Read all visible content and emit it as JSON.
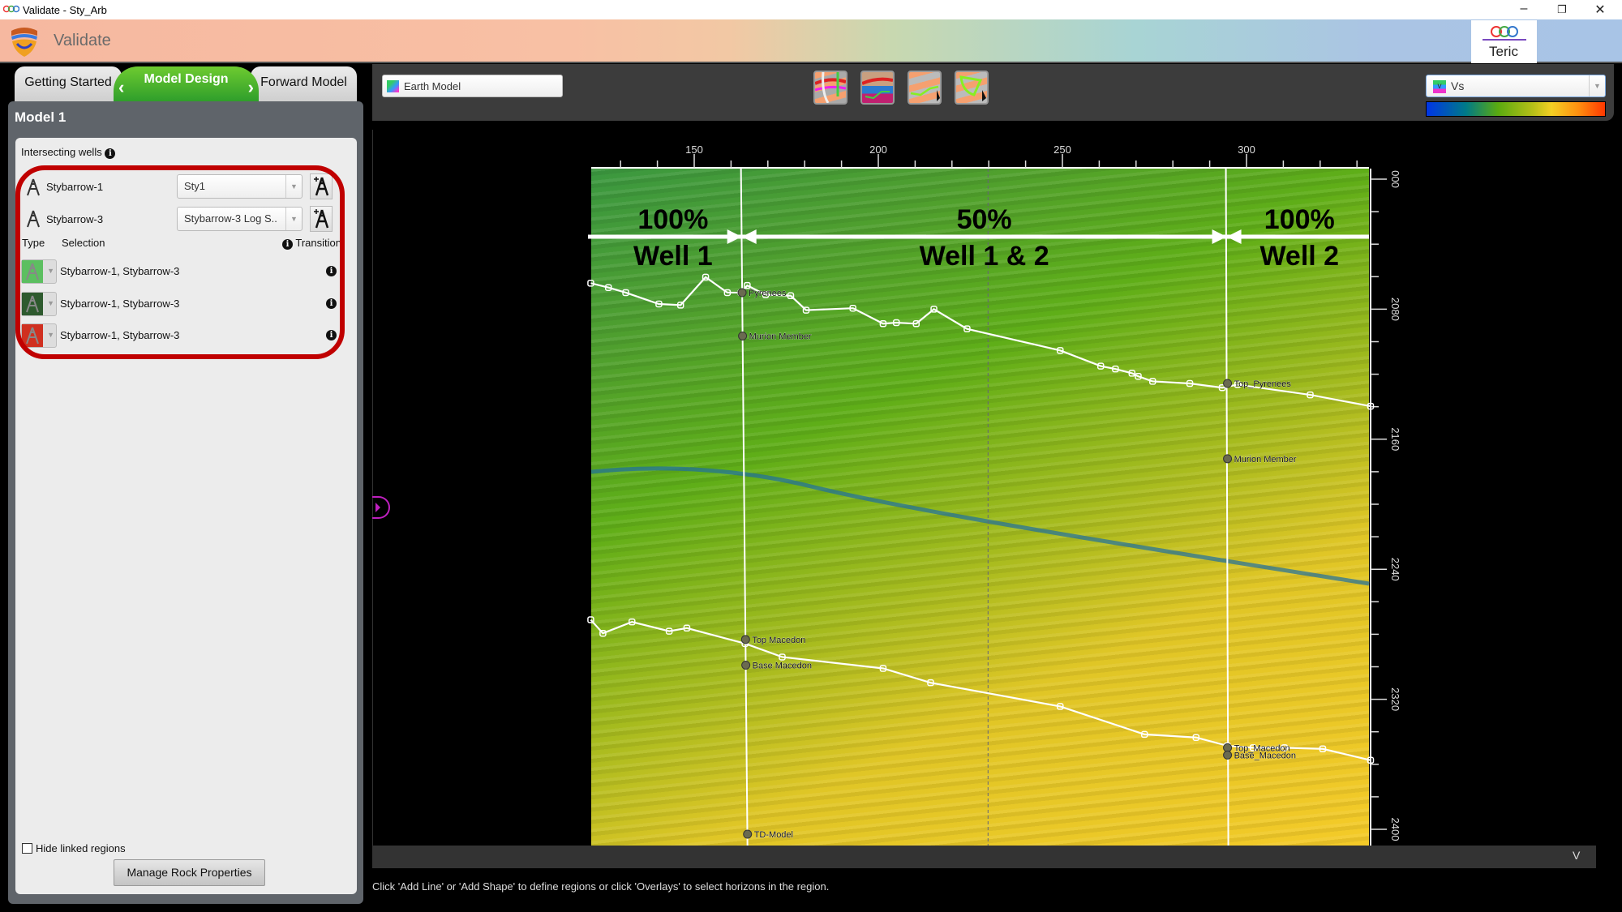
{
  "window": {
    "title": "Validate - Sty_Arb",
    "controls": [
      "minimize",
      "restore",
      "close"
    ]
  },
  "header": {
    "app_name": "Validate",
    "logo_text": "GEO TERIC"
  },
  "tabs": [
    {
      "label": "Getting Started"
    },
    {
      "label": "Model Design",
      "active": true
    },
    {
      "label": "Forward Model"
    }
  ],
  "panel": {
    "title": "Model 1",
    "intersecting_wells_label": "Intersecting wells",
    "wells": [
      {
        "name": "Stybarrow-1",
        "log": "Sty1"
      },
      {
        "name": "Stybarrow-3",
        "log": "Stybarrow-3 Log S.."
      }
    ],
    "columns": {
      "type": "Type",
      "selection": "Selection",
      "transition": "Transition"
    },
    "regions": [
      {
        "selection": "Stybarrow-1, Stybarrow-3",
        "color": "#5cbf60"
      },
      {
        "selection": "Stybarrow-1, Stybarrow-3",
        "color": "#2e5a2e"
      },
      {
        "selection": "Stybarrow-1, Stybarrow-3",
        "color": "#d03020"
      }
    ],
    "hide_linked_label": "Hide linked regions",
    "hide_linked_checked": false,
    "manage_button": "Manage Rock Properties",
    "highlight_color": "#c00000"
  },
  "toolbar": {
    "earth_model": "Earth Model",
    "tools": [
      "well-section-icon",
      "overlay-icon",
      "add-line-icon",
      "add-shape-icon"
    ],
    "attribute": "Vs",
    "colorbar": [
      "#0035e6",
      "#007a88",
      "#5aaa10",
      "#f5d024",
      "#ff9010",
      "#ff3800"
    ]
  },
  "section": {
    "x_range": [
      122,
      334
    ],
    "y_range": [
      1993,
      2411
    ],
    "x_ticks": [
      150,
      200,
      250,
      300
    ],
    "y_ticks": [
      {
        "v": 2000,
        "label": "000"
      },
      {
        "v": 2080,
        "label": "2080"
      },
      {
        "v": 2160,
        "label": "2160"
      },
      {
        "v": 2240,
        "label": "2240"
      },
      {
        "v": 2320,
        "label": "2320"
      },
      {
        "v": 2400,
        "label": "2400"
      }
    ],
    "annotations": [
      {
        "pct": "100%",
        "label": "Well 1"
      },
      {
        "pct": "50%",
        "label": "Well 1 & 2"
      },
      {
        "pct": "100%",
        "label": "Well 2"
      }
    ],
    "wells": [
      {
        "x": 162.7,
        "markers": [
          {
            "d": 2069.8,
            "name": "Pyrenees"
          },
          {
            "d": 2096.5,
            "name": "Murion Member"
          },
          {
            "d": 2283.2,
            "name": "Top Macedon"
          },
          {
            "d": 2299,
            "name": "Base Macedon"
          },
          {
            "d": 2403,
            "name": "TD-Model"
          }
        ]
      },
      {
        "x": 294.4,
        "markers": [
          {
            "d": 2125.7,
            "name": "Top_Pyrenees"
          },
          {
            "d": 2172,
            "name": "Murion Member"
          },
          {
            "d": 2349.8,
            "name": "Top_Macedon"
          },
          {
            "d": 2354.3,
            "name": "Base_Macedon"
          }
        ]
      }
    ],
    "transition_x": 229.8,
    "horizons": [
      {
        "points": [
          [
            121.9,
            2064
          ],
          [
            126.7,
            2066.7
          ],
          [
            131.4,
            2069.8
          ],
          [
            140.4,
            2076.8
          ],
          [
            146.3,
            2077.5
          ],
          [
            153.1,
            2060.3
          ],
          [
            159,
            2069.8
          ],
          [
            162.7,
            2069.8
          ],
          [
            164.4,
            2065.4
          ],
          [
            169.4,
            2071.1
          ],
          [
            176.2,
            2071.7
          ],
          [
            180.4,
            2080.6
          ],
          [
            193.1,
            2079.4
          ],
          [
            201.3,
            2088.9
          ],
          [
            204.9,
            2088.3
          ],
          [
            210.3,
            2088.9
          ],
          [
            215.1,
            2080
          ],
          [
            224.1,
            2092.1
          ],
          [
            249.4,
            2105.4
          ],
          [
            260.4,
            2115
          ],
          [
            264.4,
            2116.8
          ],
          [
            268.9,
            2119.4
          ],
          [
            270.6,
            2121.3
          ],
          [
            274.5,
            2124.4
          ],
          [
            284.6,
            2125.7
          ],
          [
            293.4,
            2128.3
          ],
          [
            297.6,
            2126.4
          ],
          [
            317.3,
            2132.7
          ],
          [
            333.7,
            2139.7
          ]
        ]
      },
      {
        "points": [
          [
            121.9,
            2271.1
          ],
          [
            125.2,
            2279.4
          ],
          [
            133.1,
            2272.4
          ],
          [
            143.2,
            2278.1
          ],
          [
            148,
            2276.2
          ],
          [
            163.8,
            2285.7
          ],
          [
            173.9,
            2294
          ],
          [
            201.3,
            2301
          ],
          [
            214.2,
            2309.8
          ],
          [
            249.4,
            2324.4
          ],
          [
            272.3,
            2341.6
          ],
          [
            286.3,
            2343.5
          ],
          [
            294.8,
            2348.6
          ],
          [
            301.8,
            2349.8
          ],
          [
            310.3,
            2349.8
          ],
          [
            320.7,
            2350.5
          ],
          [
            333.7,
            2357.5
          ]
        ]
      }
    ]
  },
  "status": "Click 'Add Line' or 'Add Shape' to define regions or click 'Overlays' to select horizons in the region."
}
